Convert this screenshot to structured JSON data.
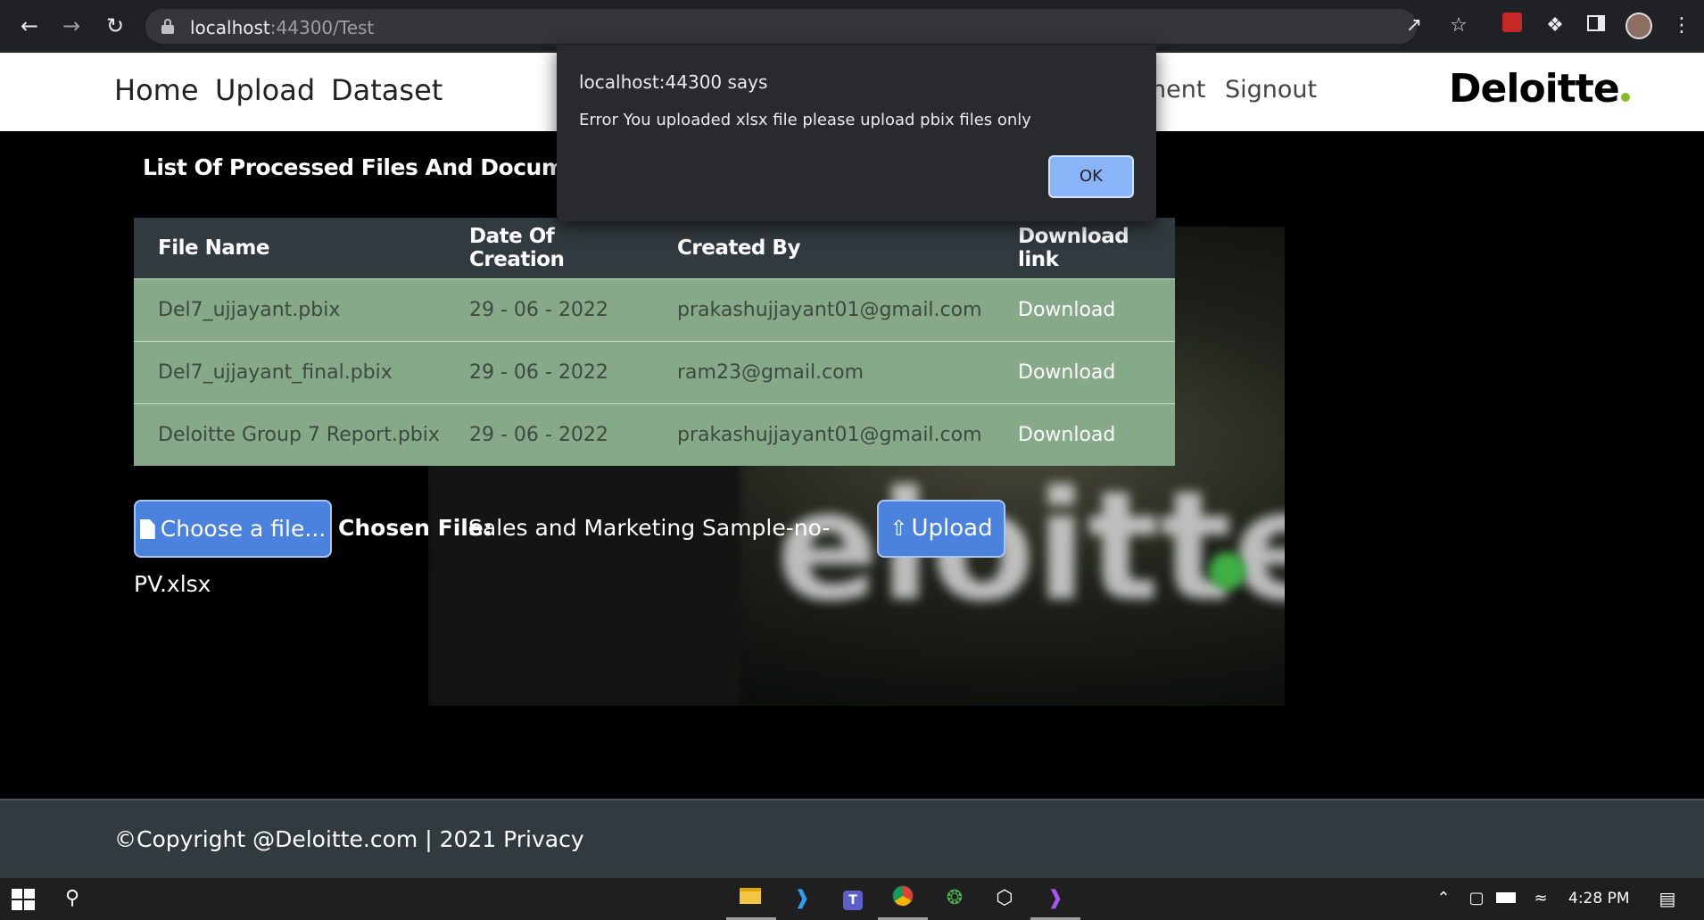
{
  "browser": {
    "url_host": "localhost",
    "url_rest": ":44300/Test"
  },
  "header": {
    "nav": [
      "Home",
      "Upload",
      "Dataset"
    ],
    "nav_partial": "nent",
    "signout": "Signout",
    "logo": "Deloitte",
    "logo_dot_color": "#86bc25"
  },
  "main": {
    "section_title": "List Of Processed Files And Document M",
    "table": {
      "columns": [
        "File Name",
        "Date Of Creation",
        "Created By",
        "Download link"
      ],
      "rows": [
        [
          "Del7_ujjayant.pbix",
          "29 - 06 - 2022",
          "prakashujjayant01@gmail.com",
          "Download"
        ],
        [
          "Del7_ujjayant_final.pbix",
          "29 - 06 - 2022",
          "ram23@gmail.com",
          "Download"
        ],
        [
          "Deloitte Group 7 Report.pbix",
          "29 - 06 - 2022",
          "prakashujjayant01@gmail.com",
          "Download"
        ]
      ]
    },
    "choose_button": "Choose a file...",
    "chosen_label": "Chosen File:",
    "chosen_file_line1": "Sales and Marketing Sample-no-",
    "chosen_file_line2": "PV.xlsx",
    "upload_button": "Upload"
  },
  "footer": {
    "text": "©Copyright @Deloitte.com | 2021 Privacy"
  },
  "alert": {
    "title": "localhost:44300 says",
    "message": "Error You uploaded xlsx file please upload pbix files only",
    "ok": "OK"
  },
  "taskbar": {
    "time": "4:28 PM"
  },
  "colors": {
    "table_header": "#313a3e",
    "table_row": "#86a98a",
    "button": "#4b82de",
    "alert_ok": "#8ab4f8"
  }
}
